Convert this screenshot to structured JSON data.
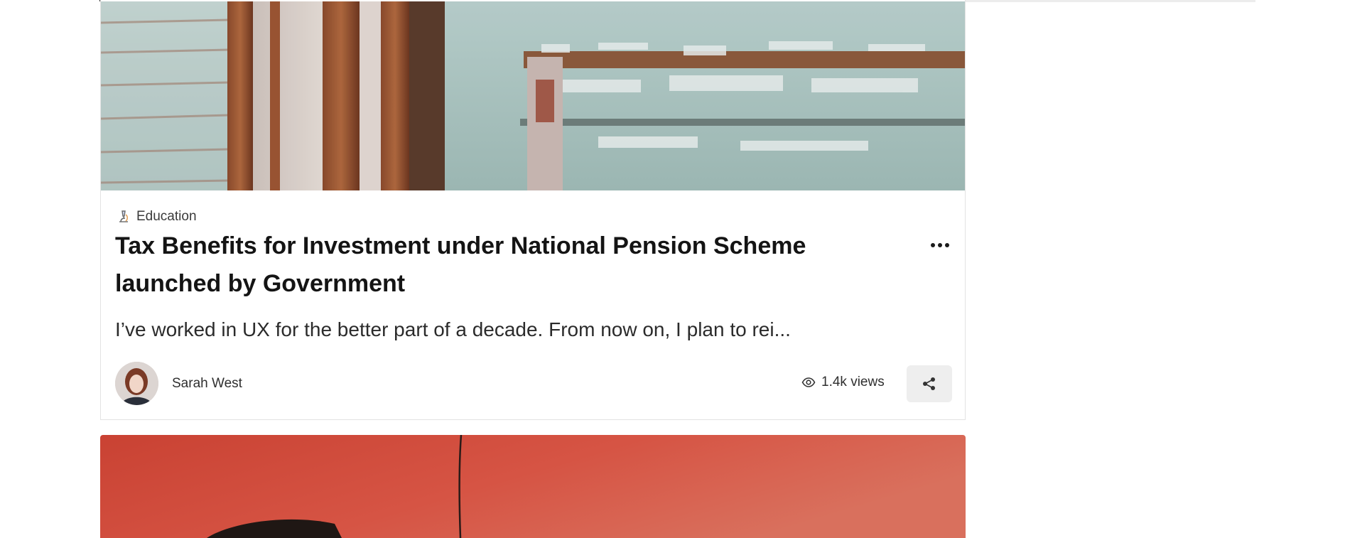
{
  "colors": {
    "share_button_bg": "#eeeeee",
    "card_border": "#e3e3e3",
    "second_card_image": "#d44d3c"
  },
  "post": {
    "image": "weathered-wood-wall-photo",
    "category": {
      "icon": "microscope-icon",
      "label": "Education"
    },
    "title": "Tax Benefits for Investment under National Pension Scheme launched by Government",
    "more_icon": "more-horizontal-icon",
    "excerpt": "I’ve worked in UX for the better part of a decade. From now on, I plan to rei...",
    "author": {
      "name": "Sarah West",
      "avatar": "author-avatar-photo"
    },
    "views": {
      "icon": "eye-icon",
      "label": "1.4k views"
    },
    "share_icon": "share-icon"
  },
  "next_post": {
    "image": "red-car-door-photo"
  }
}
